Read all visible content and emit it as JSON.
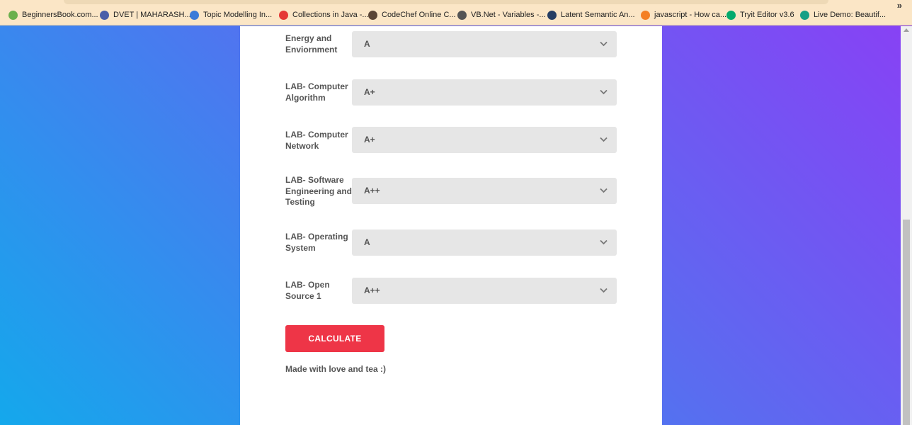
{
  "bookmarks": [
    {
      "label": "BeginnersBook.com...",
      "icon": "beginnersbook-icon",
      "color": "#6ab04c"
    },
    {
      "label": "DVET | MAHARASH...",
      "icon": "dvet-icon",
      "color": "#4a5ea8"
    },
    {
      "label": "Topic Modelling In...",
      "icon": "chart-line-icon",
      "color": "#3b7bd8"
    },
    {
      "label": "Collections in Java -...",
      "icon": "triangle-icon",
      "color": "#e53935"
    },
    {
      "label": "CodeChef Online C...",
      "icon": "codechef-icon",
      "color": "#5b4636"
    },
    {
      "label": "VB.Net - Variables -...",
      "icon": "diamond-icon",
      "color": "#555555"
    },
    {
      "label": "Latent Semantic An...",
      "icon": "datacamp-icon",
      "color": "#263e63"
    },
    {
      "label": "javascript - How ca...",
      "icon": "stackoverflow-icon",
      "color": "#f48024"
    },
    {
      "label": "Tryit Editor v3.6",
      "icon": "w3schools-icon",
      "color": "#04aa6d"
    },
    {
      "label": "Live Demo: Beautif...",
      "icon": "shield-icon",
      "color": "#16a085"
    }
  ],
  "bookmarks_more": "»",
  "subjects": [
    {
      "name": "Energy and Enviornment",
      "grade": "A"
    },
    {
      "name": "LAB- Computer Algorithm",
      "grade": "A+"
    },
    {
      "name": "LAB- Computer Network",
      "grade": "A+"
    },
    {
      "name": "LAB- Software Engineering and Testing",
      "grade": "A++"
    },
    {
      "name": "LAB- Operating System",
      "grade": "A"
    },
    {
      "name": "LAB- Open Source 1",
      "grade": "A++"
    }
  ],
  "calculate_label": "CALCULATE",
  "footer_note": "Made with love and tea :)",
  "colors": {
    "button": "#ee3547",
    "select_bg": "#e6e6e6",
    "label_text": "#555555"
  }
}
